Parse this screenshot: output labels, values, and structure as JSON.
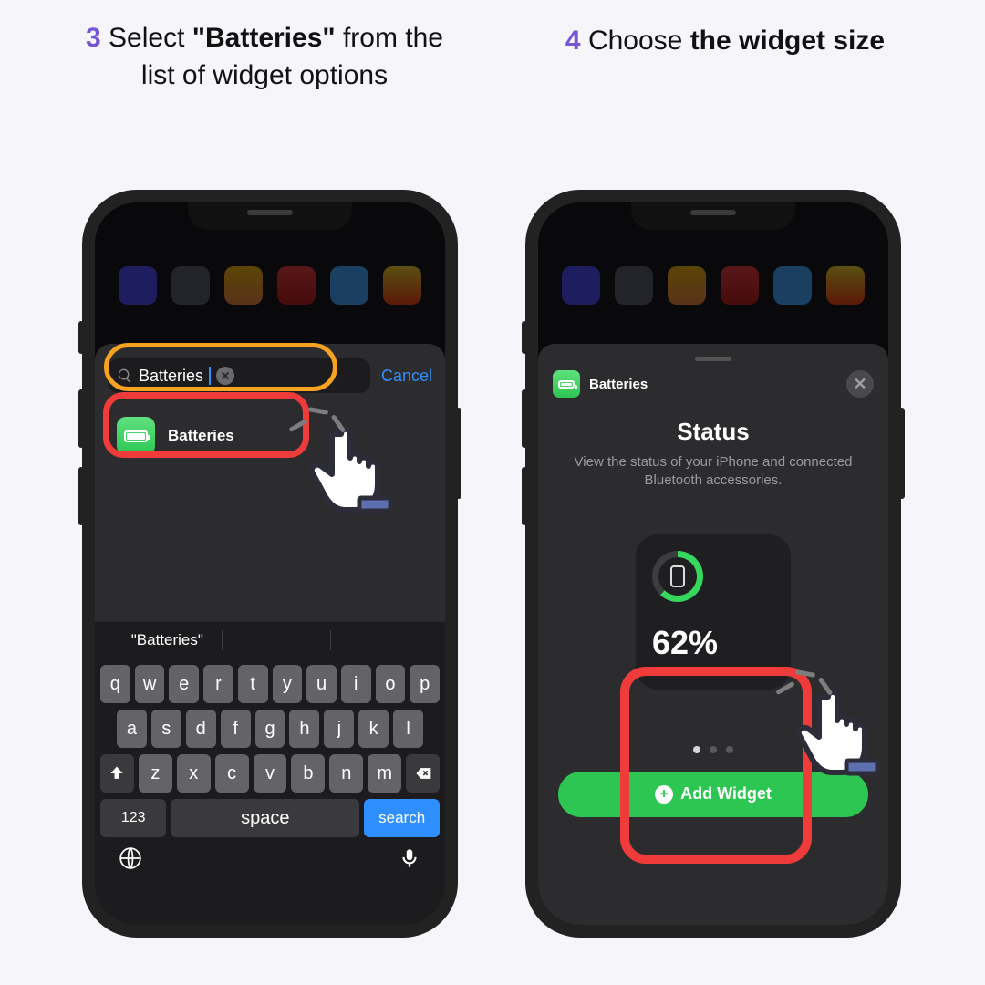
{
  "steps": {
    "s3": {
      "num": "3",
      "before": " Select ",
      "bold": "\"Batteries\"",
      "after": " from the list of widget options"
    },
    "s4": {
      "num": "4",
      "before": " Choose ",
      "bold": "the widget size",
      "after": ""
    }
  },
  "left": {
    "search_value": "Batteries",
    "cancel": "Cancel",
    "result_label": "Batteries",
    "suggestion": "\"Batteries\"",
    "keys": {
      "r1": [
        "q",
        "w",
        "e",
        "r",
        "t",
        "y",
        "u",
        "i",
        "o",
        "p"
      ],
      "r2": [
        "a",
        "s",
        "d",
        "f",
        "g",
        "h",
        "j",
        "k",
        "l"
      ],
      "r3": [
        "z",
        "x",
        "c",
        "v",
        "b",
        "n",
        "m"
      ],
      "num": "123",
      "space": "space",
      "search": "search"
    }
  },
  "right": {
    "header_label": "Batteries",
    "title": "Status",
    "desc": "View the status of your iPhone and connected Bluetooth accessories.",
    "percent": "62%",
    "add": "Add Widget"
  }
}
